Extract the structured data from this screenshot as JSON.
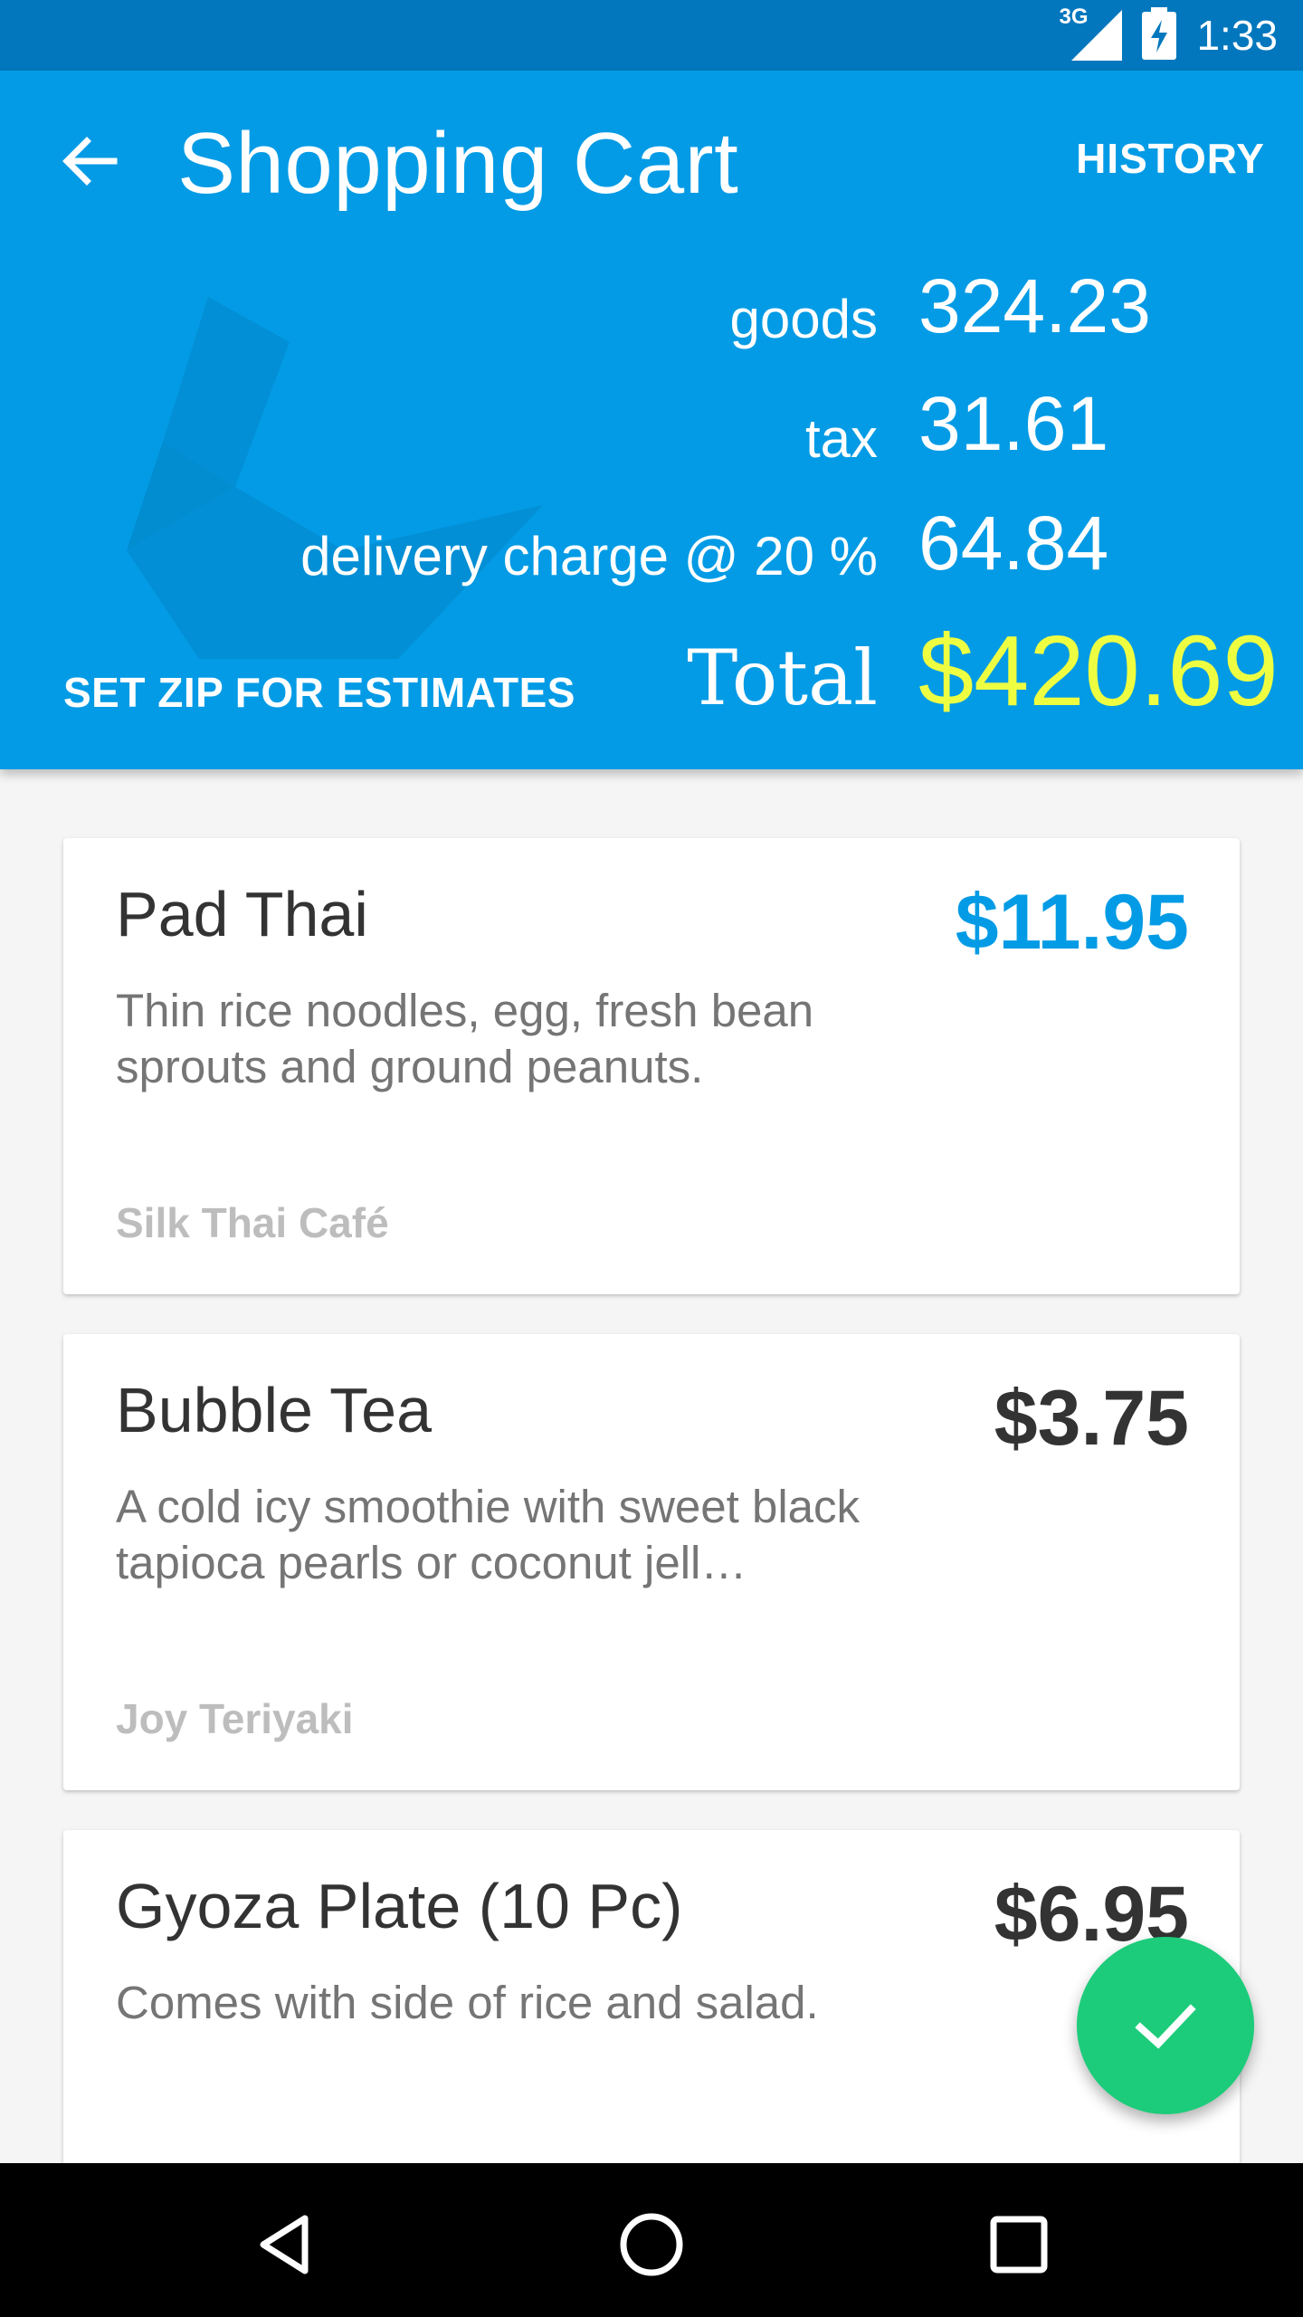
{
  "status_bar": {
    "network": "3G",
    "time": "1:33"
  },
  "header": {
    "title": "Shopping Cart",
    "history_label": "HISTORY",
    "zip_button_label": "SET ZIP FOR ESTIMATES",
    "background_color": "#039be5"
  },
  "summary": {
    "goods_label": "goods",
    "goods_value": "324.23",
    "tax_label": "tax",
    "tax_value": "31.61",
    "delivery_label": "delivery charge @ 20 %",
    "delivery_value": "64.84",
    "total_label": "Total",
    "total_value": "$420.69",
    "total_color": "#eeff41"
  },
  "items": [
    {
      "name": "Pad Thai",
      "description": "Thin rice noodles, egg, fresh bean sprouts and ground peanuts.",
      "vendor": "Silk Thai Café",
      "price": "$11.95",
      "price_color": "#039be5"
    },
    {
      "name": "Bubble Tea",
      "description": "A cold icy smoothie with sweet black tapioca pearls or coconut jell…",
      "vendor": "Joy Teriyaki",
      "price": "$3.75",
      "price_color": "#333333"
    },
    {
      "name": "Gyoza Plate (10 Pc)",
      "description": "Comes with side of rice and salad.",
      "vendor": "",
      "price": "$6.95",
      "price_color": "#333333"
    }
  ],
  "fab": {
    "icon": "check-icon",
    "color": "#1ccc7a"
  },
  "nav_bar": {
    "icons": [
      "back-triangle-icon",
      "home-circle-icon",
      "recents-square-icon"
    ]
  }
}
